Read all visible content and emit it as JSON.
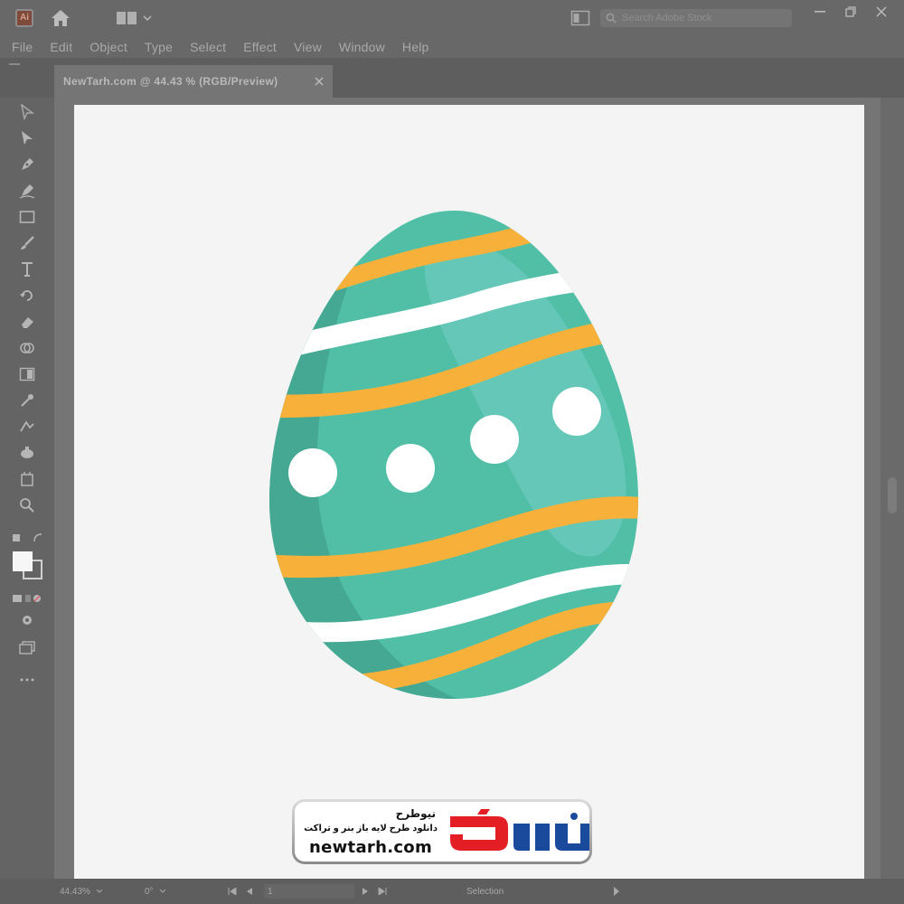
{
  "app": {
    "menu": [
      "File",
      "Edit",
      "Object",
      "Type",
      "Select",
      "Effect",
      "View",
      "Window",
      "Help"
    ],
    "search_placeholder": "Search Adobe Stock",
    "logo_letters": "Ai"
  },
  "document": {
    "tab_title": "NewTarh.com @ 44.43 % (RGB/Preview)"
  },
  "status": {
    "zoom": "44.43%",
    "rotation": "0°",
    "artboard_number": "1",
    "tool": "Selection"
  },
  "watermark": {
    "name_fa": "نیوطرح",
    "tagline_fa": "دانلود طرح لایه باز بنر و تراکت",
    "url": "newtarh.com",
    "logo_text": "نیوطرح"
  },
  "colors": {
    "egg_base": "#50bfa6",
    "egg_shadow": "#45a893",
    "egg_highlight": "#66c8b9",
    "stripe_orange": "#f7b13a",
    "stripe_white": "#ffffff",
    "logo_red": "#e31e24",
    "logo_blue": "#1a4a9c"
  }
}
